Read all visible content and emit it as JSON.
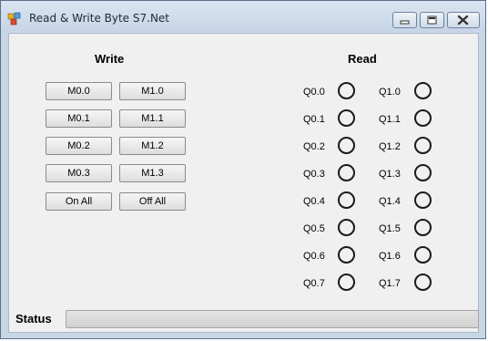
{
  "window": {
    "title": "Read & Write Byte S7.Net"
  },
  "write_panel": {
    "heading": "Write",
    "buttons": [
      {
        "left": "M0.0",
        "right": "M1.0"
      },
      {
        "left": "M0.1",
        "right": "M1.1"
      },
      {
        "left": "M0.2",
        "right": "M1.2"
      },
      {
        "left": "M0.3",
        "right": "M1.3"
      }
    ],
    "on_all": "On All",
    "off_all": "Off All"
  },
  "read_panel": {
    "heading": "Read",
    "q0": [
      "Q0.0",
      "Q0.1",
      "Q0.2",
      "Q0.3",
      "Q0.4",
      "Q0.5",
      "Q0.6",
      "Q0.7"
    ],
    "q1": [
      "Q1.0",
      "Q1.1",
      "Q1.2",
      "Q1.3",
      "Q1.4",
      "Q1.5",
      "Q1.6",
      "Q1.7"
    ]
  },
  "status": {
    "label": "Status",
    "value": ""
  },
  "colors": {
    "led_off": "#f0f0f0"
  },
  "icons": {
    "app": "app-icon",
    "minimize": "minimize-icon",
    "maximize": "maximize-icon",
    "close": "close-icon"
  }
}
